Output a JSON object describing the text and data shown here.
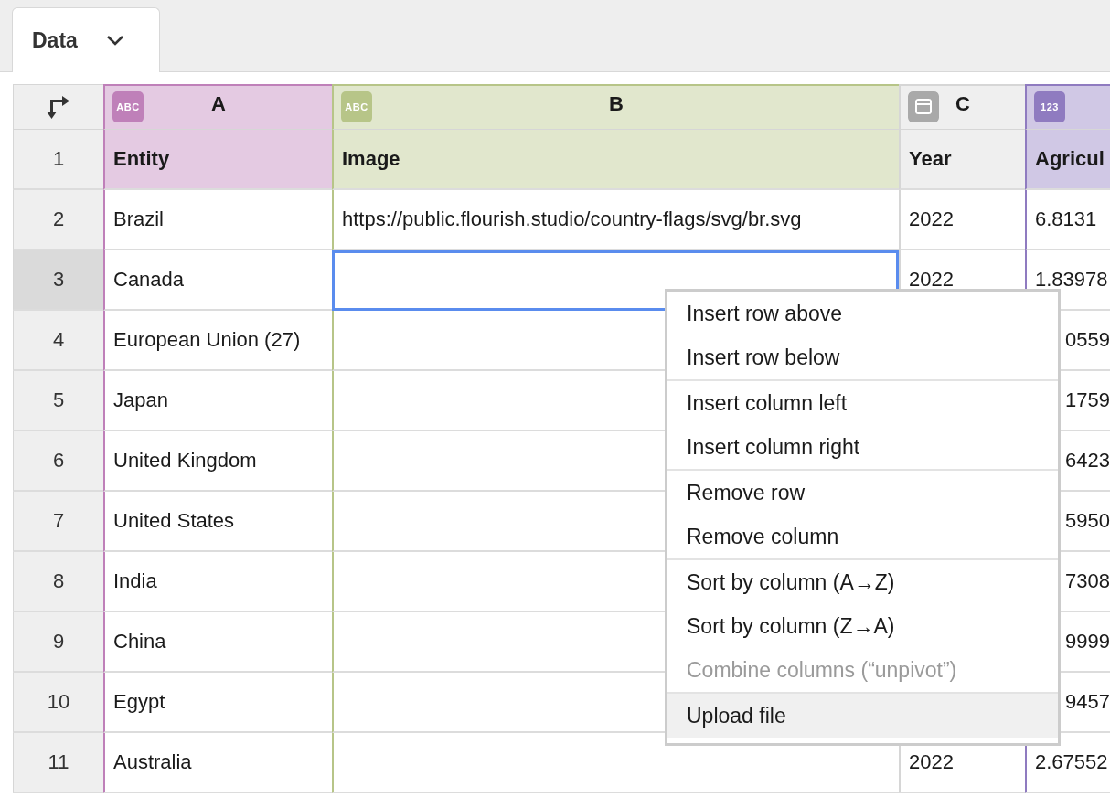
{
  "tab": {
    "label": "Data"
  },
  "columns": [
    {
      "letter": "A",
      "kind": "text",
      "badge": "ABC",
      "color": "#bf80b9"
    },
    {
      "letter": "B",
      "kind": "text",
      "badge": "ABC",
      "color": "#b7c588"
    },
    {
      "letter": "C",
      "kind": "date",
      "color": "#a9a9a9"
    },
    {
      "kind": "number",
      "badge": "123",
      "color": "#8f7bc0"
    }
  ],
  "rows": [
    {
      "number": "1",
      "kind": "header",
      "selected": false,
      "cells": [
        {
          "text": "Entity",
          "selected": false
        },
        {
          "text": "Image",
          "selected": false
        },
        {
          "text": "Year",
          "selected": false
        },
        {
          "text": "Agricul",
          "selected": false
        }
      ]
    },
    {
      "number": "2",
      "kind": "data",
      "selected": false,
      "cells": [
        {
          "text": "Brazil",
          "selected": false
        },
        {
          "text": "https://public.flourish.studio/country-flags/svg/br.svg",
          "selected": false
        },
        {
          "text": "2022",
          "selected": false
        },
        {
          "text": "6.8131",
          "selected": false
        }
      ]
    },
    {
      "number": "3",
      "kind": "data",
      "selected": true,
      "cells": [
        {
          "text": "Canada",
          "selected": false
        },
        {
          "selected": true
        },
        {
          "text": "2022",
          "selected": false
        },
        {
          "text": "1.83978",
          "selected": false
        }
      ]
    },
    {
      "number": "4",
      "kind": "data",
      "selected": false,
      "cells": [
        {
          "text": "European Union (27)",
          "selected": false
        },
        {
          "selected": false
        },
        {},
        {
          "text": "0559",
          "selected": false,
          "clipped": true
        }
      ]
    },
    {
      "number": "5",
      "kind": "data",
      "selected": false,
      "cells": [
        {
          "text": "Japan",
          "selected": false
        },
        {
          "selected": false
        },
        {},
        {
          "text": "1759",
          "selected": false,
          "clipped": true
        }
      ]
    },
    {
      "number": "6",
      "kind": "data",
      "selected": false,
      "cells": [
        {
          "text": "United Kingdom",
          "selected": false
        },
        {
          "selected": false
        },
        {},
        {
          "text": "6423",
          "selected": false,
          "clipped": true
        }
      ]
    },
    {
      "number": "7",
      "kind": "data",
      "selected": false,
      "cells": [
        {
          "text": "United States",
          "selected": false
        },
        {
          "selected": false
        },
        {},
        {
          "text": "5950",
          "selected": false,
          "clipped": true
        }
      ]
    },
    {
      "number": "8",
      "kind": "data",
      "selected": false,
      "cells": [
        {
          "text": "India",
          "selected": false
        },
        {
          "selected": false
        },
        {},
        {
          "text": "7308",
          "selected": false,
          "clipped": true
        }
      ]
    },
    {
      "number": "9",
      "kind": "data",
      "selected": false,
      "cells": [
        {
          "text": "China",
          "selected": false
        },
        {
          "selected": false
        },
        {},
        {
          "text": "9999",
          "selected": false,
          "clipped": true
        }
      ]
    },
    {
      "number": "10",
      "kind": "data",
      "selected": false,
      "cells": [
        {
          "text": "Egypt",
          "selected": false
        },
        {
          "selected": false
        },
        {},
        {
          "text": "9457",
          "selected": false,
          "clipped": true
        }
      ]
    },
    {
      "number": "11",
      "kind": "data",
      "selected": false,
      "cells": [
        {
          "text": "Australia",
          "selected": false
        },
        {
          "selected": false
        },
        {
          "text": "2022",
          "selected": false
        },
        {
          "text": "2.67552",
          "selected": false
        }
      ]
    }
  ],
  "context_menu": {
    "groups": [
      [
        {
          "label": "Insert row above",
          "disabled": false,
          "hovered": false
        },
        {
          "label": "Insert row below",
          "disabled": false,
          "hovered": false
        }
      ],
      [
        {
          "label": "Insert column left",
          "disabled": false,
          "hovered": false
        },
        {
          "label": "Insert column right",
          "disabled": false,
          "hovered": false
        }
      ],
      [
        {
          "label": "Remove row",
          "disabled": false,
          "hovered": false
        },
        {
          "label": "Remove column",
          "disabled": false,
          "hovered": false
        }
      ],
      [
        {
          "label": "Sort by column (A→Z)",
          "disabled": false,
          "hovered": false
        },
        {
          "label": "Sort by column (Z→A)",
          "disabled": false,
          "hovered": false
        },
        {
          "label": "Combine columns (“unpivot”)",
          "disabled": true,
          "hovered": false
        }
      ],
      [
        {
          "label": "Upload file",
          "disabled": false,
          "hovered": true
        }
      ]
    ]
  }
}
